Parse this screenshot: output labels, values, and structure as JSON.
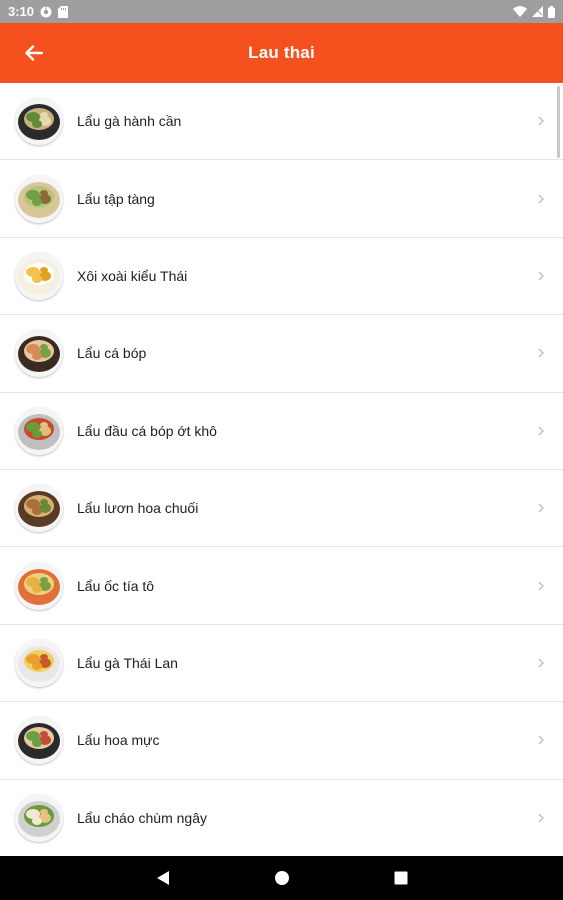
{
  "status_bar": {
    "time": "3:10",
    "icons": [
      "chrome-icon",
      "sd-card-icon",
      "wifi-icon",
      "signal-icon",
      "battery-icon"
    ]
  },
  "app_bar": {
    "title": "Lau thai",
    "back_icon": "arrow-back-icon",
    "color": "#f4511e"
  },
  "items": [
    {
      "label": "Lẩu gà hành cần",
      "plate": "#2b2b2b",
      "food": [
        "#5e8c3a",
        "#c8b27c",
        "#e8d8b0"
      ]
    },
    {
      "label": "Lẩu tập tàng",
      "plate": "#d9c79a",
      "food": [
        "#6fa044",
        "#b8c47a",
        "#8a6a3a"
      ]
    },
    {
      "label": "Xôi xoài kiểu Thái",
      "plate": "#f5f0e0",
      "food": [
        "#f2c14e",
        "#ffffff",
        "#e4a020"
      ]
    },
    {
      "label": "Lẩu cá bóp",
      "plate": "#3a2a22",
      "food": [
        "#d98a5a",
        "#e8c8a0",
        "#7aa040"
      ]
    },
    {
      "label": "Lẩu đầu cá bóp ớt khô",
      "plate": "#bfbfbf",
      "food": [
        "#6a9a3a",
        "#c84a2a",
        "#e0c080"
      ]
    },
    {
      "label": "Lẩu lươn hoa chuối",
      "plate": "#5a3a22",
      "food": [
        "#a8703a",
        "#d8b070",
        "#6a8a3a"
      ]
    },
    {
      "label": "Lẩu ốc tía tô",
      "plate": "#e0703a",
      "food": [
        "#e8b040",
        "#f0d080",
        "#7aa040"
      ]
    },
    {
      "label": "Lẩu gà Thái Lan",
      "plate": "#e8e8e8",
      "food": [
        "#e8a030",
        "#f2d060",
        "#c85a2a"
      ]
    },
    {
      "label": "Lẩu hoa mực",
      "plate": "#2a2a2a",
      "food": [
        "#6aa044",
        "#e8c8a0",
        "#c84a3a"
      ]
    },
    {
      "label": "Lẩu cháo chùm ngây",
      "plate": "#d0d0d0",
      "food": [
        "#f0e8d0",
        "#6a9a3a",
        "#e8c080"
      ]
    }
  ],
  "nav_bar": {
    "back": "nav-back-icon",
    "home": "nav-home-icon",
    "recents": "nav-recents-icon"
  }
}
